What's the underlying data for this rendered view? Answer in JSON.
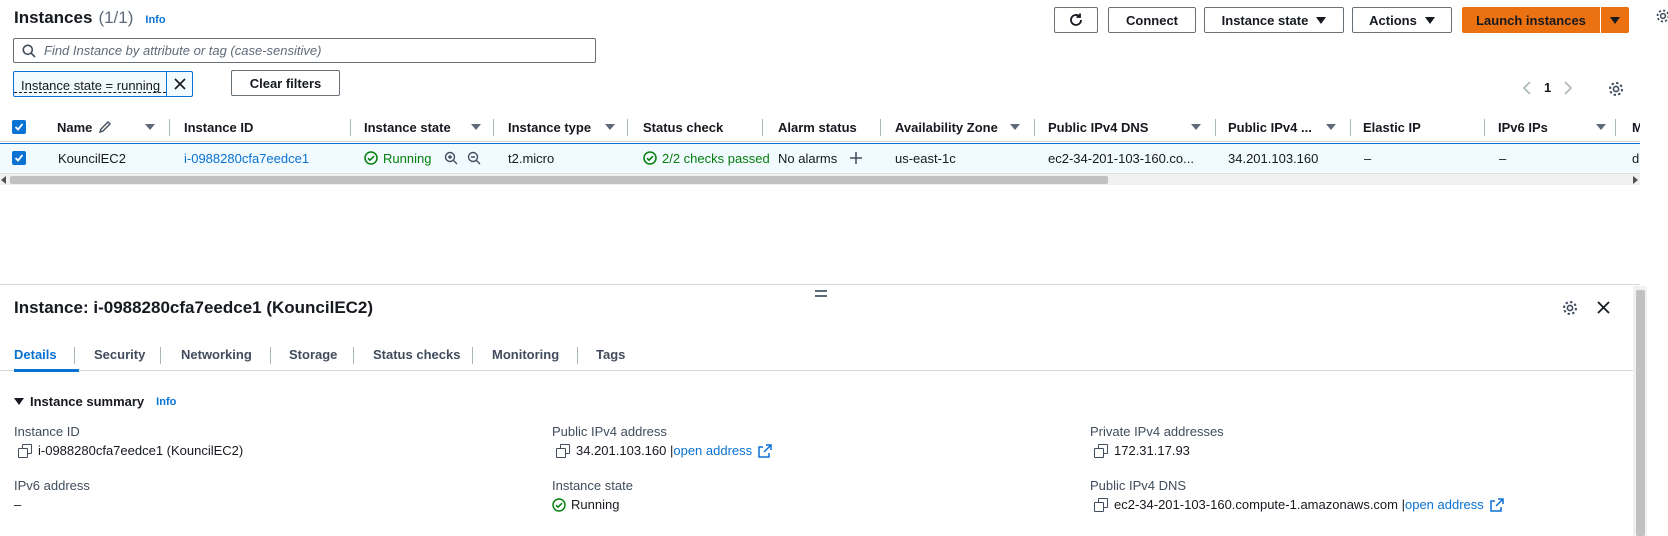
{
  "list": {
    "title": "Instances",
    "count": "(1/1)",
    "info": "Info"
  },
  "toolbar": {
    "connect": "Connect",
    "instance_state": "Instance state",
    "actions": "Actions",
    "launch": "Launch instances"
  },
  "search": {
    "placeholder": "Find Instance by attribute or tag (case-sensitive)"
  },
  "filter": {
    "token": "Instance state = running",
    "clear": "Clear filters"
  },
  "pagination": {
    "page": "1"
  },
  "table": {
    "headers": {
      "name": "Name",
      "instance_id": "Instance ID",
      "instance_state": "Instance state",
      "instance_type": "Instance type",
      "status_check": "Status check",
      "alarm_status": "Alarm status",
      "availability_zone": "Availability Zone",
      "public_dns": "Public IPv4 DNS",
      "public_ip": "Public IPv4 ...",
      "elastic_ip": "Elastic IP",
      "ipv6": "IPv6 IPs",
      "more": "Mo"
    },
    "row": {
      "name": "KouncilEC2",
      "instance_id": "i-0988280cfa7eedce1",
      "state": "Running",
      "type": "t2.micro",
      "status": "2/2 checks passed",
      "alarm": "No alarms",
      "az": "us-east-1c",
      "public_dns": "ec2-34-201-103-160.co...",
      "public_ip": "34.201.103.160",
      "elastic_ip": "–",
      "ipv6": "–",
      "more": "dis"
    }
  },
  "details": {
    "title": "Instance: i-0988280cfa7eedce1 (KouncilEC2)",
    "tabs": [
      "Details",
      "Security",
      "Networking",
      "Storage",
      "Status checks",
      "Monitoring",
      "Tags"
    ],
    "summary_label": "Instance summary",
    "summary_info": "Info",
    "fields": {
      "instance_id_label": "Instance ID",
      "instance_id_value": "i-0988280cfa7eedce1 (KouncilEC2)",
      "public_ip_label": "Public IPv4 address",
      "public_ip_value": "34.201.103.160 |",
      "open_address": "open address",
      "private_ip_label": "Private IPv4 addresses",
      "private_ip_value": "172.31.17.93",
      "ipv6_label": "IPv6 address",
      "ipv6_value": "–",
      "state_label": "Instance state",
      "state_value": "Running",
      "public_dns_label": "Public IPv4 DNS",
      "public_dns_value": "ec2-34-201-103-160.compute-1.amazonaws.com |"
    }
  },
  "colors": {
    "accent": "#0972d3",
    "primary": "#ec7211",
    "success": "#037f0c"
  }
}
